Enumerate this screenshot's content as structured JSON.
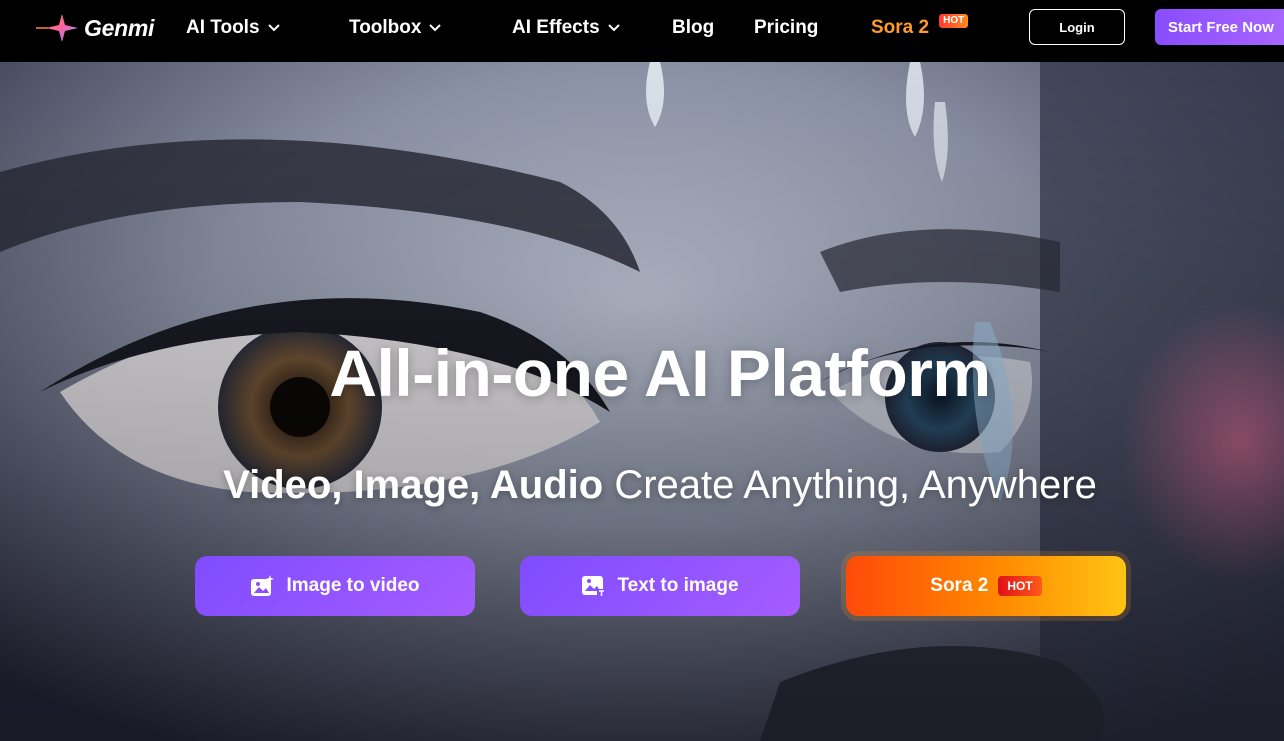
{
  "brand": {
    "name": "Genmi"
  },
  "nav": {
    "items": [
      {
        "label": "AI Tools",
        "has_dropdown": true
      },
      {
        "label": "Toolbox",
        "has_dropdown": true
      },
      {
        "label": "AI Effects",
        "has_dropdown": true
      },
      {
        "label": "Blog",
        "has_dropdown": false
      },
      {
        "label": "Pricing",
        "has_dropdown": false
      }
    ],
    "sora": {
      "label": "Sora 2",
      "badge": "HOT"
    },
    "login_label": "Login",
    "start_label": "Start Free Now"
  },
  "hero": {
    "headline": "All-in-one AI Platform",
    "subline_bold": "Video, Image, Audio",
    "subline_rest": " Create Anything, Anywhere",
    "buttons": [
      {
        "label": "Image to video",
        "icon": "image-video-icon"
      },
      {
        "label": "Text to image",
        "icon": "image-text-icon"
      },
      {
        "label": "Sora 2",
        "badge": "HOT"
      }
    ]
  },
  "colors": {
    "accent_purple": "#8a4dff",
    "accent_orange": "#ff7a0a",
    "nav_bg": "#000000"
  }
}
